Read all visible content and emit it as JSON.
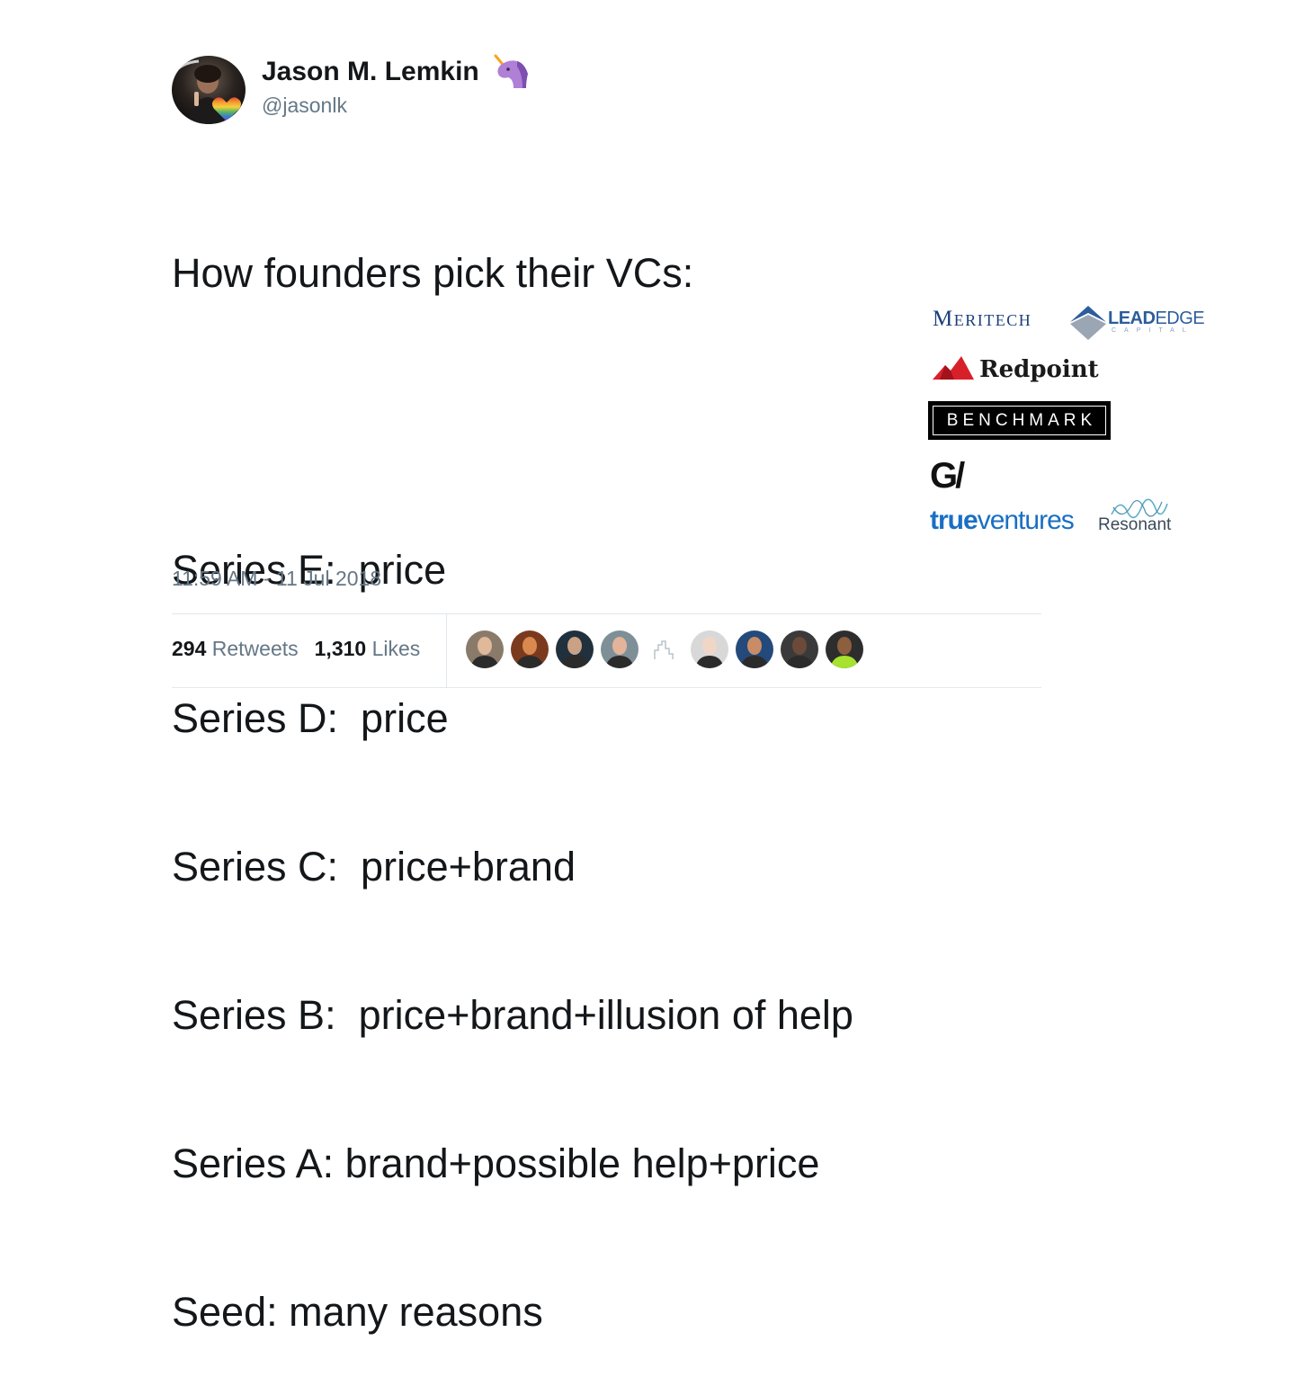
{
  "tweet": {
    "author_name": "Jason M. Lemkin",
    "author_handle": "@jasonlk",
    "lines": [
      "How founders pick their VCs:",
      "",
      "Series E:  price",
      "Series D:  price",
      "Series C:  price+brand",
      "Series B:  price+brand+illusion of help",
      "Series A: brand+possible help+price",
      "Seed: many reasons"
    ],
    "timestamp": "11:59 AM - 11 Jul 2018"
  },
  "stats": {
    "retweets_count": "294",
    "retweets_label": "Retweets",
    "likes_count": "1,310",
    "likes_label": "Likes"
  },
  "logos": {
    "meritech": "Meritech",
    "leadedge_lead": "LEAD",
    "leadedge_edge": "EDGE",
    "leadedge_sub": "CAPITAL",
    "redpoint": "Redpoint",
    "benchmark": "BENCHMARK",
    "gv": "G/",
    "trueventures_bold": "true",
    "trueventures_rest": "ventures",
    "resonant": "Resonant"
  },
  "icons": {
    "author_badge": "unicorn-icon",
    "avatar_badge": "rainbow-heart-icon"
  },
  "colors": {
    "text": "#14171a",
    "secondary": "#657786",
    "divider": "#e1e8ed",
    "meritech": "#1b3f7a",
    "leadedge": "#2c5d9c",
    "redpoint": "#d8202a",
    "trueventures": "#1a6fc4"
  },
  "likers": [
    {
      "name": "liker-1",
      "bg": "#8a7a6a",
      "face": "#e0b89a"
    },
    {
      "name": "liker-2",
      "bg": "#7b3a1e",
      "face": "#d9894f"
    },
    {
      "name": "liker-3",
      "bg": "#20303c",
      "face": "#caa184"
    },
    {
      "name": "liker-4",
      "bg": "#7f8f98",
      "face": "#e3b49a"
    },
    {
      "name": "liker-5",
      "bg": "#ffffff",
      "face": "#b9c3cc"
    },
    {
      "name": "liker-6",
      "bg": "#d8d8d8",
      "face": "#f0d6c6"
    },
    {
      "name": "liker-7",
      "bg": "#234a7a",
      "face": "#c98c66"
    },
    {
      "name": "liker-8",
      "bg": "#3a3a3a",
      "face": "#6b4a3a"
    },
    {
      "name": "liker-9",
      "bg": "#2d2d2d",
      "face": "#8c5f3f"
    }
  ]
}
